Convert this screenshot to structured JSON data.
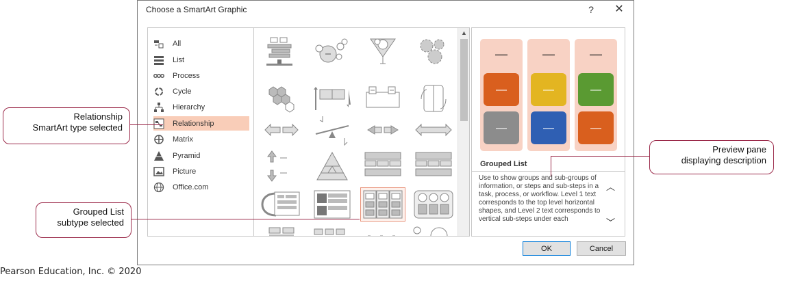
{
  "dialog": {
    "title": "Choose a SmartArt Graphic",
    "help_label": "?",
    "close_label": "✕",
    "ok_label": "OK",
    "cancel_label": "Cancel"
  },
  "categories": [
    {
      "label": "All",
      "icon": "all-icon"
    },
    {
      "label": "List",
      "icon": "list-icon"
    },
    {
      "label": "Process",
      "icon": "process-icon"
    },
    {
      "label": "Cycle",
      "icon": "cycle-icon"
    },
    {
      "label": "Hierarchy",
      "icon": "hierarchy-icon"
    },
    {
      "label": "Relationship",
      "icon": "relationship-icon",
      "selected": true
    },
    {
      "label": "Matrix",
      "icon": "matrix-icon"
    },
    {
      "label": "Pyramid",
      "icon": "pyramid-icon"
    },
    {
      "label": "Picture",
      "icon": "picture-icon"
    },
    {
      "label": "Office.com",
      "icon": "globe-icon"
    }
  ],
  "preview": {
    "name": "Grouped List",
    "description": "Use to show groups and sub-groups of information, or steps and sub-steps in a task, process, or workflow. Level 1 text corresponds to the top level horizontal shapes, and Level 2 text corresponds to vertical sub-steps under each",
    "dash": "—",
    "column_colors": [
      "#f8d2c4",
      "#f8d2c4",
      "#f8d2c4"
    ],
    "box_colors": [
      [
        "#d95f1e",
        "#8c8c8c"
      ],
      [
        "#e3b521",
        "#2f5fb3"
      ],
      [
        "#5a9a32",
        "#d95f1e"
      ]
    ]
  },
  "callouts": {
    "relationship": "Relationship SmartArt type selected",
    "relationship_line1": "Relationship",
    "relationship_line2": "SmartArt type selected",
    "preview_line1": "Preview pane",
    "preview_line2": "displaying description",
    "grouped_line1": "Grouped List",
    "grouped_line2": "subtype selected"
  },
  "credit": "Pearson Education, Inc. © 2020",
  "colors": {
    "accent": "#9b2a4a",
    "selection": "#f9cdb8"
  }
}
